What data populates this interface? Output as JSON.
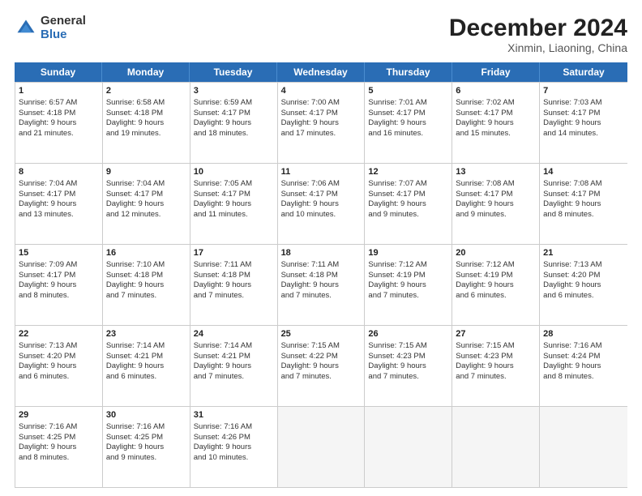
{
  "logo": {
    "general": "General",
    "blue": "Blue"
  },
  "header": {
    "month": "December 2024",
    "location": "Xinmin, Liaoning, China"
  },
  "weekdays": [
    "Sunday",
    "Monday",
    "Tuesday",
    "Wednesday",
    "Thursday",
    "Friday",
    "Saturday"
  ],
  "rows": [
    [
      {
        "day": "1",
        "lines": [
          "Sunrise: 6:57 AM",
          "Sunset: 4:18 PM",
          "Daylight: 9 hours",
          "and 21 minutes."
        ]
      },
      {
        "day": "2",
        "lines": [
          "Sunrise: 6:58 AM",
          "Sunset: 4:18 PM",
          "Daylight: 9 hours",
          "and 19 minutes."
        ]
      },
      {
        "day": "3",
        "lines": [
          "Sunrise: 6:59 AM",
          "Sunset: 4:17 PM",
          "Daylight: 9 hours",
          "and 18 minutes."
        ]
      },
      {
        "day": "4",
        "lines": [
          "Sunrise: 7:00 AM",
          "Sunset: 4:17 PM",
          "Daylight: 9 hours",
          "and 17 minutes."
        ]
      },
      {
        "day": "5",
        "lines": [
          "Sunrise: 7:01 AM",
          "Sunset: 4:17 PM",
          "Daylight: 9 hours",
          "and 16 minutes."
        ]
      },
      {
        "day": "6",
        "lines": [
          "Sunrise: 7:02 AM",
          "Sunset: 4:17 PM",
          "Daylight: 9 hours",
          "and 15 minutes."
        ]
      },
      {
        "day": "7",
        "lines": [
          "Sunrise: 7:03 AM",
          "Sunset: 4:17 PM",
          "Daylight: 9 hours",
          "and 14 minutes."
        ]
      }
    ],
    [
      {
        "day": "8",
        "lines": [
          "Sunrise: 7:04 AM",
          "Sunset: 4:17 PM",
          "Daylight: 9 hours",
          "and 13 minutes."
        ]
      },
      {
        "day": "9",
        "lines": [
          "Sunrise: 7:04 AM",
          "Sunset: 4:17 PM",
          "Daylight: 9 hours",
          "and 12 minutes."
        ]
      },
      {
        "day": "10",
        "lines": [
          "Sunrise: 7:05 AM",
          "Sunset: 4:17 PM",
          "Daylight: 9 hours",
          "and 11 minutes."
        ]
      },
      {
        "day": "11",
        "lines": [
          "Sunrise: 7:06 AM",
          "Sunset: 4:17 PM",
          "Daylight: 9 hours",
          "and 10 minutes."
        ]
      },
      {
        "day": "12",
        "lines": [
          "Sunrise: 7:07 AM",
          "Sunset: 4:17 PM",
          "Daylight: 9 hours",
          "and 9 minutes."
        ]
      },
      {
        "day": "13",
        "lines": [
          "Sunrise: 7:08 AM",
          "Sunset: 4:17 PM",
          "Daylight: 9 hours",
          "and 9 minutes."
        ]
      },
      {
        "day": "14",
        "lines": [
          "Sunrise: 7:08 AM",
          "Sunset: 4:17 PM",
          "Daylight: 9 hours",
          "and 8 minutes."
        ]
      }
    ],
    [
      {
        "day": "15",
        "lines": [
          "Sunrise: 7:09 AM",
          "Sunset: 4:17 PM",
          "Daylight: 9 hours",
          "and 8 minutes."
        ]
      },
      {
        "day": "16",
        "lines": [
          "Sunrise: 7:10 AM",
          "Sunset: 4:18 PM",
          "Daylight: 9 hours",
          "and 7 minutes."
        ]
      },
      {
        "day": "17",
        "lines": [
          "Sunrise: 7:11 AM",
          "Sunset: 4:18 PM",
          "Daylight: 9 hours",
          "and 7 minutes."
        ]
      },
      {
        "day": "18",
        "lines": [
          "Sunrise: 7:11 AM",
          "Sunset: 4:18 PM",
          "Daylight: 9 hours",
          "and 7 minutes."
        ]
      },
      {
        "day": "19",
        "lines": [
          "Sunrise: 7:12 AM",
          "Sunset: 4:19 PM",
          "Daylight: 9 hours",
          "and 7 minutes."
        ]
      },
      {
        "day": "20",
        "lines": [
          "Sunrise: 7:12 AM",
          "Sunset: 4:19 PM",
          "Daylight: 9 hours",
          "and 6 minutes."
        ]
      },
      {
        "day": "21",
        "lines": [
          "Sunrise: 7:13 AM",
          "Sunset: 4:20 PM",
          "Daylight: 9 hours",
          "and 6 minutes."
        ]
      }
    ],
    [
      {
        "day": "22",
        "lines": [
          "Sunrise: 7:13 AM",
          "Sunset: 4:20 PM",
          "Daylight: 9 hours",
          "and 6 minutes."
        ]
      },
      {
        "day": "23",
        "lines": [
          "Sunrise: 7:14 AM",
          "Sunset: 4:21 PM",
          "Daylight: 9 hours",
          "and 6 minutes."
        ]
      },
      {
        "day": "24",
        "lines": [
          "Sunrise: 7:14 AM",
          "Sunset: 4:21 PM",
          "Daylight: 9 hours",
          "and 7 minutes."
        ]
      },
      {
        "day": "25",
        "lines": [
          "Sunrise: 7:15 AM",
          "Sunset: 4:22 PM",
          "Daylight: 9 hours",
          "and 7 minutes."
        ]
      },
      {
        "day": "26",
        "lines": [
          "Sunrise: 7:15 AM",
          "Sunset: 4:23 PM",
          "Daylight: 9 hours",
          "and 7 minutes."
        ]
      },
      {
        "day": "27",
        "lines": [
          "Sunrise: 7:15 AM",
          "Sunset: 4:23 PM",
          "Daylight: 9 hours",
          "and 7 minutes."
        ]
      },
      {
        "day": "28",
        "lines": [
          "Sunrise: 7:16 AM",
          "Sunset: 4:24 PM",
          "Daylight: 9 hours",
          "and 8 minutes."
        ]
      }
    ],
    [
      {
        "day": "29",
        "lines": [
          "Sunrise: 7:16 AM",
          "Sunset: 4:25 PM",
          "Daylight: 9 hours",
          "and 8 minutes."
        ]
      },
      {
        "day": "30",
        "lines": [
          "Sunrise: 7:16 AM",
          "Sunset: 4:25 PM",
          "Daylight: 9 hours",
          "and 9 minutes."
        ]
      },
      {
        "day": "31",
        "lines": [
          "Sunrise: 7:16 AM",
          "Sunset: 4:26 PM",
          "Daylight: 9 hours",
          "and 10 minutes."
        ]
      },
      {
        "day": "",
        "lines": []
      },
      {
        "day": "",
        "lines": []
      },
      {
        "day": "",
        "lines": []
      },
      {
        "day": "",
        "lines": []
      }
    ]
  ]
}
